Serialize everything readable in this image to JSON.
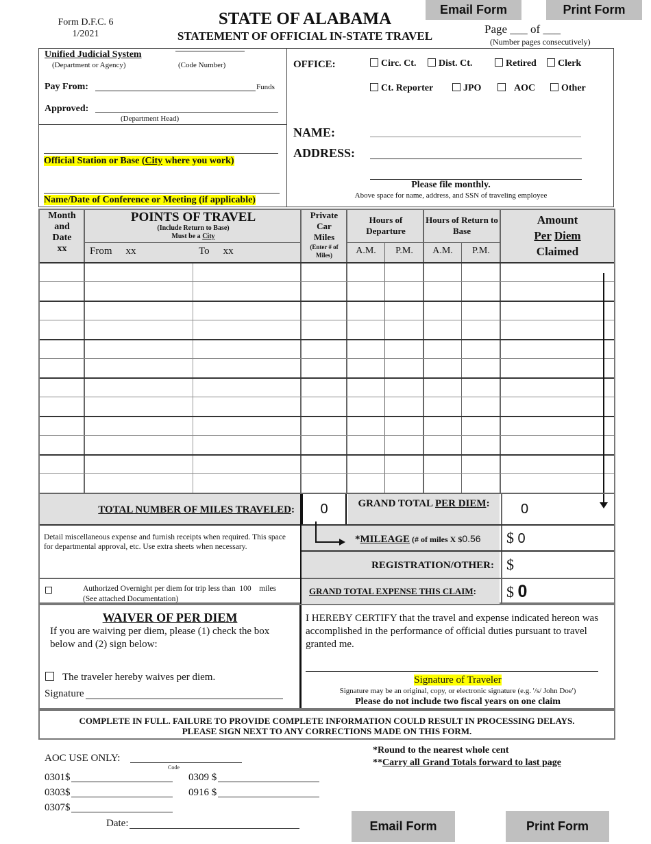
{
  "header": {
    "form_id": "Form D.F.C. 6",
    "form_date": "1/2021",
    "title": "STATE OF ALABAMA",
    "subtitle": "STATEMENT OF OFFICIAL IN-STATE TRAVEL",
    "page_label": "Page ___ of ___",
    "page_note": "(Number pages consecutively)",
    "email_button": "Email Form",
    "print_button": "Print Form"
  },
  "agency": {
    "department": "Unified Judicial System",
    "department_caption": "(Department or Agency)",
    "code_caption": "(Code Number)",
    "pay_from_label": "Pay From:",
    "funds_label": "Funds",
    "approved_label": "Approved:",
    "approved_caption": "(Department Head)",
    "official_station_label": "Official Station or Base (City where you work)",
    "official_station_pre": "Official Station or Base (",
    "official_station_city": "City",
    "official_station_post": " where you work)",
    "conference_label": "Name/Date of Conference or Meeting (if applicable)"
  },
  "office": {
    "label": "OFFICE:",
    "options_row1": [
      "Circ. Ct.",
      "Dist. Ct.",
      "Retired",
      "Clerk"
    ],
    "options_row2": [
      "Ct. Reporter",
      "JPO",
      "AOC",
      "Other"
    ],
    "name_label": "NAME:",
    "address_label": "ADDRESS:",
    "file_note": "Please file monthly.",
    "space_note": "Above space for name, address, and SSN of traveling employee"
  },
  "table": {
    "col_month": [
      "Month",
      "and",
      "Date",
      "xx"
    ],
    "points_title": "POINTS OF TRAVEL",
    "points_sub1": "(Include Return to Base)",
    "points_sub2_pre": "Must be a ",
    "points_sub2_city": "City",
    "from_label": "From",
    "from_xx": "xx",
    "to_label": "To",
    "to_xx": "xx",
    "car_miles": [
      "Private",
      "Car",
      "Miles"
    ],
    "car_miles_note": "(Enter # of Miles)",
    "departure_title": "Hours of Departure",
    "return_title": "Hours of Return to Base",
    "am": "A.M.",
    "pm": "P.M.",
    "amount_1": "Amount",
    "amount_per": "Per",
    "amount_diem": "Diem",
    "amount_3": "Claimed",
    "row_count": 12
  },
  "totals": {
    "total_miles_label": "TOTAL NUMBER OF MILES TRAVELED",
    "total_miles_value": "0",
    "grand_per_diem_label_pre": "GRAND TOTAL ",
    "grand_per_diem_label_u": "PER DIEM",
    "grand_per_diem_value": "0",
    "misc_note": "Detail miscellaneous expense and furnish receipts when required.  This space for departmental approval, etc.  Use extra sheets when necessary.",
    "mileage_label_pre": "*",
    "mileage_label_u": "MILEAGE",
    "mileage_label_post": " (# of  miles X $",
    "mileage_rate": "0.56",
    "mileage_value": "0",
    "registration_label": "REGISTRATION/OTHER:",
    "registration_value": "",
    "grand_expense_label": "GRAND TOTAL EXPENSE THIS CLAIM",
    "grand_expense_value": "0",
    "currency": "$",
    "overnight_note": "Authorized Overnight per diem for trip less than",
    "overnight_miles": "100",
    "overnight_unit": "miles",
    "overnight_doc": "(See attached Documentation)"
  },
  "waiver": {
    "title": "WAIVER OF PER DIEM",
    "instructions": "If you are waiving per diem, please (1) check the box below and (2) sign below:",
    "checkbox_label": "The traveler hereby waives per diem.",
    "signature_label": "Signature"
  },
  "certify": {
    "text": "I HEREBY CERTIFY that the travel and expense indicated hereon was accomplished in the performance of official duties pursuant to travel granted me.",
    "signature_label": "Signature of Traveler",
    "signature_note": "Signature may be an original, copy, or electronic signature (e.g. '/s/ John Doe')",
    "fiscal_note": "Please do not include two fiscal years on one claim"
  },
  "notice": {
    "line1": "COMPLETE IN FULL.  FAILURE TO PROVIDE COMPLETE INFORMATION COULD RESULT IN PROCESSING DELAYS.",
    "line2": "PLEASE SIGN NEXT TO ANY CORRECTIONS MADE ON THIS FORM."
  },
  "aoc": {
    "label": "AOC USE ONLY:",
    "code_caption": "Code",
    "fields": [
      "0301$",
      "0303$",
      "0307$",
      "0309 $",
      "0916 $"
    ],
    "date_label": "Date:"
  },
  "footnotes": {
    "round": "*Round to the nearest whole cent",
    "carry_pre": "**",
    "carry": "Carry all Grand Totals forward to last page"
  },
  "colors": {
    "highlight": "#ffff00",
    "button": "#c0c0c0",
    "shade": "#e0e0e0"
  }
}
